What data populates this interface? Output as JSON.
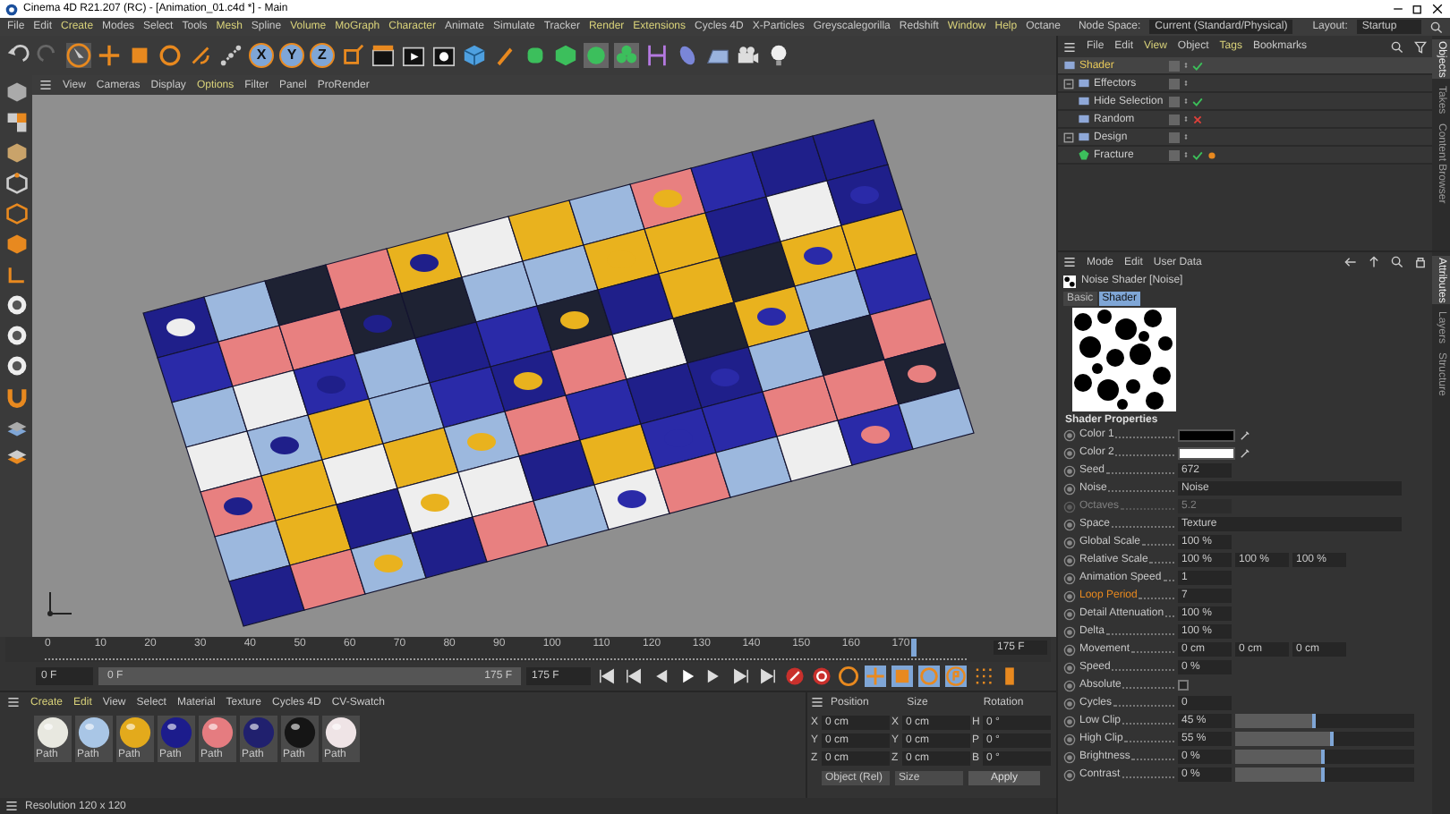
{
  "window": {
    "title": "Cinema 4D R21.207 (RC) - [Animation_01.c4d *] - Main"
  },
  "menu_bar": {
    "items": [
      {
        "label": "File",
        "highlighted": false
      },
      {
        "label": "Edit",
        "highlighted": false
      },
      {
        "label": "Create",
        "highlighted": true
      },
      {
        "label": "Modes",
        "highlighted": false
      },
      {
        "label": "Select",
        "highlighted": false
      },
      {
        "label": "Tools",
        "highlighted": false
      },
      {
        "label": "Mesh",
        "highlighted": true
      },
      {
        "label": "Spline",
        "highlighted": false
      },
      {
        "label": "Volume",
        "highlighted": true
      },
      {
        "label": "MoGraph",
        "highlighted": true
      },
      {
        "label": "Character",
        "highlighted": true
      },
      {
        "label": "Animate",
        "highlighted": false
      },
      {
        "label": "Simulate",
        "highlighted": false
      },
      {
        "label": "Tracker",
        "highlighted": false
      },
      {
        "label": "Render",
        "highlighted": true
      },
      {
        "label": "Extensions",
        "highlighted": true
      },
      {
        "label": "Cycles 4D",
        "highlighted": false
      },
      {
        "label": "X-Particles",
        "highlighted": false
      },
      {
        "label": "Greyscalegorilla",
        "highlighted": false
      },
      {
        "label": "Redshift",
        "highlighted": false
      },
      {
        "label": "Window",
        "highlighted": true
      },
      {
        "label": "Help",
        "highlighted": true
      },
      {
        "label": "Octane",
        "highlighted": false
      }
    ],
    "node_space": {
      "label": "Node Space:",
      "value": "Current (Standard/Physical)"
    },
    "layout": {
      "label": "Layout:",
      "value": "Startup"
    }
  },
  "toolbar": {
    "axis_buttons": [
      "X",
      "Y",
      "Z"
    ]
  },
  "viewport": {
    "menu": [
      {
        "label": "View",
        "highlighted": false
      },
      {
        "label": "Cameras",
        "highlighted": false
      },
      {
        "label": "Display",
        "highlighted": false
      },
      {
        "label": "Options",
        "highlighted": true
      },
      {
        "label": "Filter",
        "highlighted": false
      },
      {
        "label": "Panel",
        "highlighted": false
      },
      {
        "label": "ProRender",
        "highlighted": false
      }
    ]
  },
  "timeline": {
    "ticks": [
      "0",
      "10",
      "20",
      "30",
      "40",
      "50",
      "60",
      "70",
      "80",
      "90",
      "100",
      "110",
      "120",
      "130",
      "140",
      "150",
      "160",
      "170"
    ],
    "end_field": "175 F"
  },
  "playback": {
    "current": "0 F",
    "range": {
      "start": "0 F",
      "end": "175 F",
      "level": 1
    },
    "end_frame": "175 F"
  },
  "material_manager": {
    "menu": [
      {
        "label": "Create",
        "highlighted": true
      },
      {
        "label": "Edit",
        "highlighted": true
      },
      {
        "label": "View",
        "highlighted": false
      },
      {
        "label": "Select",
        "highlighted": false
      },
      {
        "label": "Material",
        "highlighted": false
      },
      {
        "label": "Texture",
        "highlighted": false
      },
      {
        "label": "Cycles 4D",
        "highlighted": false
      },
      {
        "label": "CV-Swatch",
        "highlighted": false
      }
    ],
    "materials": [
      {
        "name": "Path",
        "color": "#e8e8e0"
      },
      {
        "name": "Path",
        "color": "#a9c6e6"
      },
      {
        "name": "Path",
        "color": "#e3aa1c"
      },
      {
        "name": "Path",
        "color": "#1c1c8c"
      },
      {
        "name": "Path",
        "color": "#e57c80"
      },
      {
        "name": "Path",
        "color": "#20206e"
      },
      {
        "name": "Path",
        "color": "#151515"
      },
      {
        "name": "Path",
        "color": "#efe4e6"
      }
    ]
  },
  "coordinates": {
    "headers": [
      "Position",
      "Size",
      "Rotation"
    ],
    "rows": [
      {
        "axis": "X",
        "position": "0 cm",
        "size_axis": "X",
        "size": "0 cm",
        "rotation_axis": "H",
        "rotation": "0 °"
      },
      {
        "axis": "Y",
        "position": "0 cm",
        "size_axis": "Y",
        "size": "0 cm",
        "rotation_axis": "P",
        "rotation": "0 °"
      },
      {
        "axis": "Z",
        "position": "0 cm",
        "size_axis": "Z",
        "size": "0 cm",
        "rotation_axis": "B",
        "rotation": "0 °"
      }
    ],
    "mode": "Object (Rel)",
    "size_mode": "Size",
    "apply": "Apply"
  },
  "status_bar": {
    "text": "Resolution 120 x 120"
  },
  "object_manager": {
    "menu": [
      {
        "label": "File",
        "highlighted": false
      },
      {
        "label": "Edit",
        "highlighted": false
      },
      {
        "label": "View",
        "highlighted": true
      },
      {
        "label": "Object",
        "highlighted": false
      },
      {
        "label": "Tags",
        "highlighted": true
      },
      {
        "label": "Bookmarks",
        "highlighted": false
      }
    ],
    "tree": [
      {
        "kind": "object",
        "name": "Shader",
        "selected": true,
        "enabled": true,
        "tag": false
      },
      {
        "kind": "group",
        "name": "Effectors",
        "selected": false,
        "tag": false,
        "expanded": true,
        "children": [
          {
            "kind": "object",
            "name": "Hide Selection",
            "selected": false,
            "enabled": true,
            "tag": false
          },
          {
            "kind": "object",
            "name": "Random",
            "selected": false,
            "enabled": false,
            "tag": false
          }
        ]
      },
      {
        "kind": "group",
        "name": "Design",
        "selected": false,
        "tag": false,
        "expanded": true,
        "children": [
          {
            "kind": "object",
            "name": "Fracture",
            "selected": false,
            "enabled": true,
            "tag": true
          }
        ]
      }
    ],
    "side_tabs": [
      {
        "label": "Objects",
        "selected": true
      },
      {
        "label": "Takes",
        "selected": false
      },
      {
        "label": "Content Browser",
        "selected": false
      }
    ]
  },
  "attributes": {
    "menu": [
      "Mode",
      "Edit",
      "User Data"
    ],
    "title": "Noise Shader [Noise]",
    "tabs": [
      {
        "label": "Basic",
        "selected": false
      },
      {
        "label": "Shader",
        "selected": true
      }
    ],
    "section": "Shader Properties",
    "rows": [
      {
        "kind": "color",
        "label": "Color 1",
        "color": "#000000",
        "disabled": false,
        "highlighted": false
      },
      {
        "kind": "color",
        "label": "Color 2",
        "color": "#ffffff",
        "disabled": false,
        "highlighted": false
      },
      {
        "kind": "number",
        "label": "Seed",
        "value": "672",
        "disabled": false,
        "highlighted": false
      },
      {
        "kind": "dropdown",
        "label": "Noise",
        "value": "Noise",
        "disabled": false,
        "highlighted": false
      },
      {
        "kind": "number",
        "label": "Octaves",
        "value": "5.2",
        "disabled": true,
        "highlighted": false
      },
      {
        "kind": "dropdown",
        "label": "Space",
        "value": "Texture",
        "disabled": false,
        "highlighted": false
      },
      {
        "kind": "number",
        "label": "Global Scale",
        "value": "100 %",
        "disabled": false,
        "highlighted": false
      },
      {
        "kind": "triple",
        "label": "Relative Scale",
        "values": [
          "100 %",
          "100 %",
          "100 %"
        ],
        "disabled": false,
        "highlighted": false
      },
      {
        "kind": "number",
        "label": "Animation Speed",
        "value": "1",
        "disabled": false,
        "highlighted": false
      },
      {
        "kind": "number",
        "label": "Loop Period",
        "value": "7",
        "disabled": false,
        "highlighted": true
      },
      {
        "kind": "number",
        "label": "Detail Attenuation",
        "value": "100 %",
        "disabled": false,
        "highlighted": false
      },
      {
        "kind": "number",
        "label": "Delta",
        "value": "100 %",
        "disabled": false,
        "highlighted": false
      },
      {
        "kind": "triple",
        "label": "Movement",
        "values": [
          "0 cm",
          "0 cm",
          "0 cm"
        ],
        "disabled": false,
        "highlighted": false
      },
      {
        "kind": "number",
        "label": "Speed",
        "value": "0 %",
        "disabled": false,
        "highlighted": false
      },
      {
        "kind": "checkbox",
        "label": "Absolute",
        "checked": false,
        "disabled": false,
        "highlighted": false
      },
      {
        "kind": "number",
        "label": "Cycles",
        "value": "0",
        "disabled": false,
        "highlighted": false
      },
      {
        "kind": "slider",
        "label": "Low Clip",
        "value": "45 %",
        "level": 0.45,
        "disabled": false,
        "highlighted": false
      },
      {
        "kind": "slider",
        "label": "High Clip",
        "value": "55 %",
        "level": 0.55,
        "disabled": false,
        "highlighted": false
      },
      {
        "kind": "slider",
        "label": "Brightness",
        "value": "0 %",
        "level": 0.5,
        "disabled": false,
        "highlighted": false
      },
      {
        "kind": "slider",
        "label": "Contrast",
        "value": "0 %",
        "level": 0.5,
        "disabled": false,
        "highlighted": false
      }
    ],
    "side_tabs": [
      {
        "label": "Attributes",
        "selected": true
      },
      {
        "label": "Layers",
        "selected": false
      },
      {
        "label": "Structure",
        "selected": false
      }
    ]
  }
}
